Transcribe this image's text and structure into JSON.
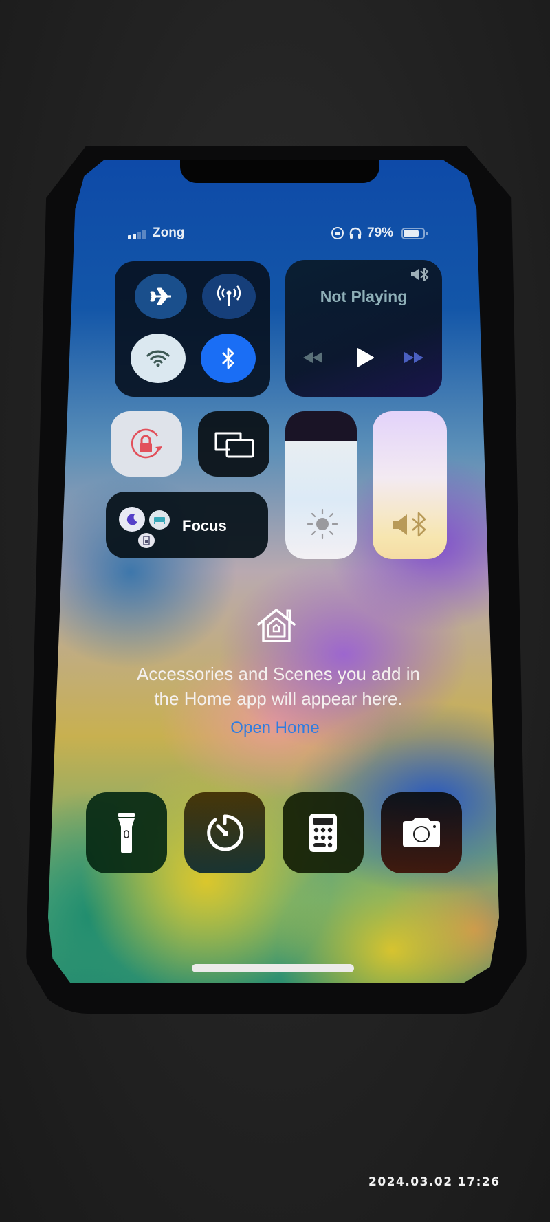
{
  "status_bar": {
    "carrier": "Zong",
    "signal_bars_active": 2,
    "signal_bars_total": 4,
    "battery_percent": "79%",
    "battery_level": 0.79,
    "icons": [
      "signal-icon",
      "orientation-lock-icon",
      "headphones-icon",
      "battery-icon"
    ]
  },
  "connectivity": {
    "airplane_mode": {
      "icon": "airplane-icon",
      "enabled": false
    },
    "cellular_data": {
      "icon": "cellular-antenna-icon",
      "enabled": false
    },
    "wifi": {
      "icon": "wifi-icon",
      "enabled": true
    },
    "bluetooth": {
      "icon": "bluetooth-icon",
      "enabled": true
    }
  },
  "now_playing": {
    "title": "Not Playing",
    "output_icon": "speaker-bluetooth-icon",
    "controls": [
      "rewind-icon",
      "play-icon",
      "fast-forward-icon"
    ]
  },
  "toggles": {
    "orientation_lock": {
      "icon": "orientation-lock-icon",
      "enabled": true
    },
    "screen_mirroring": {
      "icon": "screen-mirroring-icon"
    }
  },
  "focus": {
    "label": "Focus",
    "icons": [
      "moon-icon",
      "bed-icon",
      "badge-icon"
    ]
  },
  "sliders": {
    "brightness": {
      "icon": "sun-icon",
      "level": 0.8
    },
    "volume": {
      "icon": "speaker-bluetooth-icon",
      "level": 1.0
    }
  },
  "home": {
    "icon": "home-icon",
    "message_line1": "Accessories and Scenes you add in",
    "message_line2": "the Home app will appear here.",
    "link": "Open Home"
  },
  "shortcuts": [
    {
      "name": "flashlight",
      "icon": "flashlight-icon"
    },
    {
      "name": "timer",
      "icon": "timer-icon"
    },
    {
      "name": "calculator",
      "icon": "calculator-icon"
    },
    {
      "name": "camera",
      "icon": "camera-icon"
    }
  ],
  "photo_timestamp": "2024.03.02 17:26",
  "colors": {
    "accent_blue": "#1a6ef5",
    "link_blue": "#2f7ce0",
    "lock_red": "#e2505b"
  }
}
